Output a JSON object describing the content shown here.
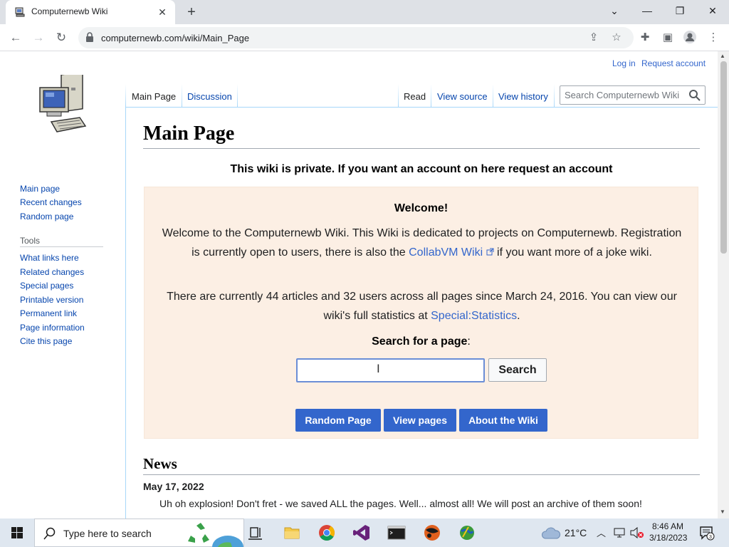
{
  "browser": {
    "tab_title": "Computernewb Wiki",
    "url": "computernewb.com/wiki/Main_Page",
    "icons": [
      "back-icon",
      "forward-icon",
      "reload-icon",
      "lock-icon",
      "share-icon",
      "bookmark-star-icon",
      "extensions-icon",
      "side-panel-icon",
      "profile-icon",
      "menu-icon"
    ]
  },
  "personal": {
    "login": "Log in",
    "request": "Request account"
  },
  "sidebar": {
    "nav": [
      "Main page",
      "Recent changes",
      "Random page"
    ],
    "tools_heading": "Tools",
    "tools": [
      "What links here",
      "Related changes",
      "Special pages",
      "Printable version",
      "Permanent link",
      "Page information",
      "Cite this page"
    ]
  },
  "page_tabs": {
    "main_page": "Main Page",
    "discussion": "Discussion",
    "read": "Read",
    "view_source": "View source",
    "view_history": "View history"
  },
  "search": {
    "placeholder": "Search Computernewb Wiki"
  },
  "content": {
    "title": "Main Page",
    "private_note": "This wiki is private. If you want an account on here request an account",
    "welcome_title": "Welcome!",
    "welcome_p1_a": "Welcome to the Computernewb Wiki. This Wiki is dedicated to projects on Computernewb. Registration is currently open to users, there is also the ",
    "welcome_p1_link": "CollabVM Wiki",
    "welcome_p1_b": " if you want more of a joke wiki.",
    "stats_a": "There are currently 44 articles and 32 users across all pages since March 24, 2016. You can view our wiki's full statistics at ",
    "stats_link": "Special:Statistics",
    "stats_b": ".",
    "search_label": "Search for a page",
    "search_colon": ":",
    "search_button": "Search",
    "btn_random": "Random Page",
    "btn_view": "View pages",
    "btn_about": "About the Wiki",
    "news_heading": "News",
    "news_date": "May 17, 2022",
    "news_text": "Uh oh explosion! Don't fret - we saved ALL the pages. Well... almost all! We will post an archive of them soon!"
  },
  "taskbar": {
    "search_placeholder": "Type here to search",
    "weather": "21°C",
    "time": "8:46 AM",
    "date": "3/18/2023",
    "notification_count": "3"
  }
}
